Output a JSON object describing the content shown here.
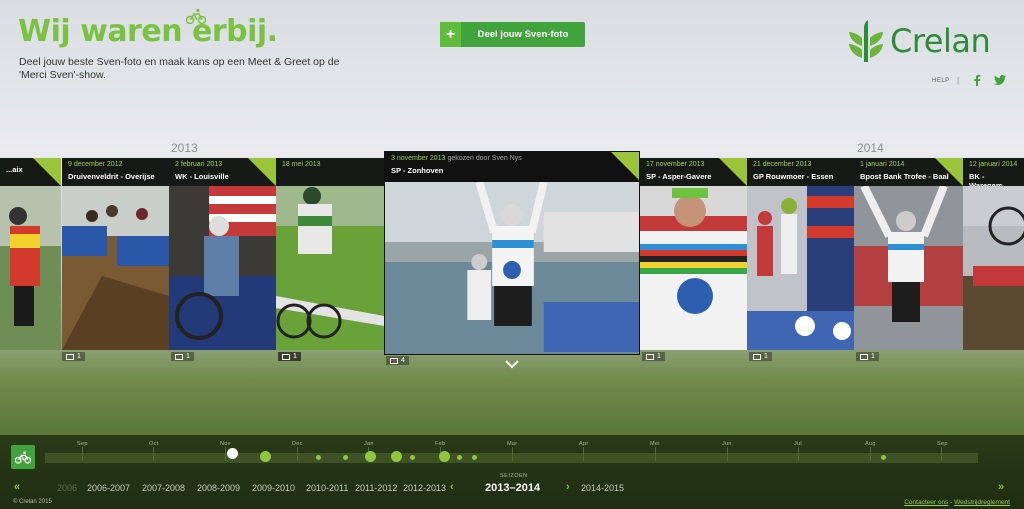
{
  "header": {
    "title": "Wij waren erbij.",
    "subtitle": "Deel jouw beste Sven-foto en maak kans op een Meet & Greet op de 'Merci Sven'-show.",
    "share_button": "Deel jouw Sven-foto",
    "brand": "Crelan",
    "help": "HELP",
    "separator": "|",
    "icons": [
      "bike-icon",
      "plus-icon",
      "facebook-icon",
      "twitter-icon"
    ]
  },
  "years": {
    "left": "2013",
    "right": "2014"
  },
  "cards": [
    {
      "date": "",
      "title": "...aix",
      "count": "1"
    },
    {
      "date": "9 december 2012",
      "title": "Druivenveldrit - Overijse",
      "count": "1"
    },
    {
      "date": "2 februari 2013",
      "title": "WK - Louisville",
      "count": "1"
    },
    {
      "date": "18 mei 2013",
      "title": "",
      "count": "1"
    },
    {
      "date": "17 november 2013",
      "title": "SP - Asper-Gavere",
      "count": "1"
    },
    {
      "date": "21 december 2013",
      "title": "GP Rouwmoer - Essen",
      "count": "1"
    },
    {
      "date": "1 januari 2014",
      "title": "Bpost Bank Trofee - Baal",
      "count": "1"
    },
    {
      "date": "12 januari 2014",
      "title": "BK - Waregem",
      "count": ""
    }
  ],
  "featured": {
    "date": "3 november 2013",
    "chosen_by": "gekozen door Sven Nys",
    "title": "SP - Zonhoven",
    "count": "4"
  },
  "timeline": {
    "months": [
      "Sep",
      "Oct",
      "Nov",
      "Dec",
      "Jan",
      "Feb",
      "Mar",
      "Apr",
      "Mei",
      "Jun",
      "Jul",
      "Aug",
      "Sep"
    ],
    "season_label": "SEIZOEN",
    "seasons_left": [
      "2006",
      "2006-2007",
      "2007-2008",
      "2008-2009",
      "2009-2010",
      "2010-2011",
      "2011-2012",
      "2012-2013"
    ],
    "active_season": "2013–2014",
    "seasons_right": [
      "2014-2015"
    ],
    "nav_prev": "«",
    "nav_next": "»",
    "season_prev": "‹",
    "season_next": "›"
  },
  "footer": {
    "copyright": "© Crelan 2015",
    "contact": "Contacteer ons",
    "rules": "Wedstrijdreglement",
    "sep": " - "
  },
  "colors": {
    "accent": "#7cc242",
    "button": "#41a33b",
    "brand": "#2e8b3a"
  }
}
